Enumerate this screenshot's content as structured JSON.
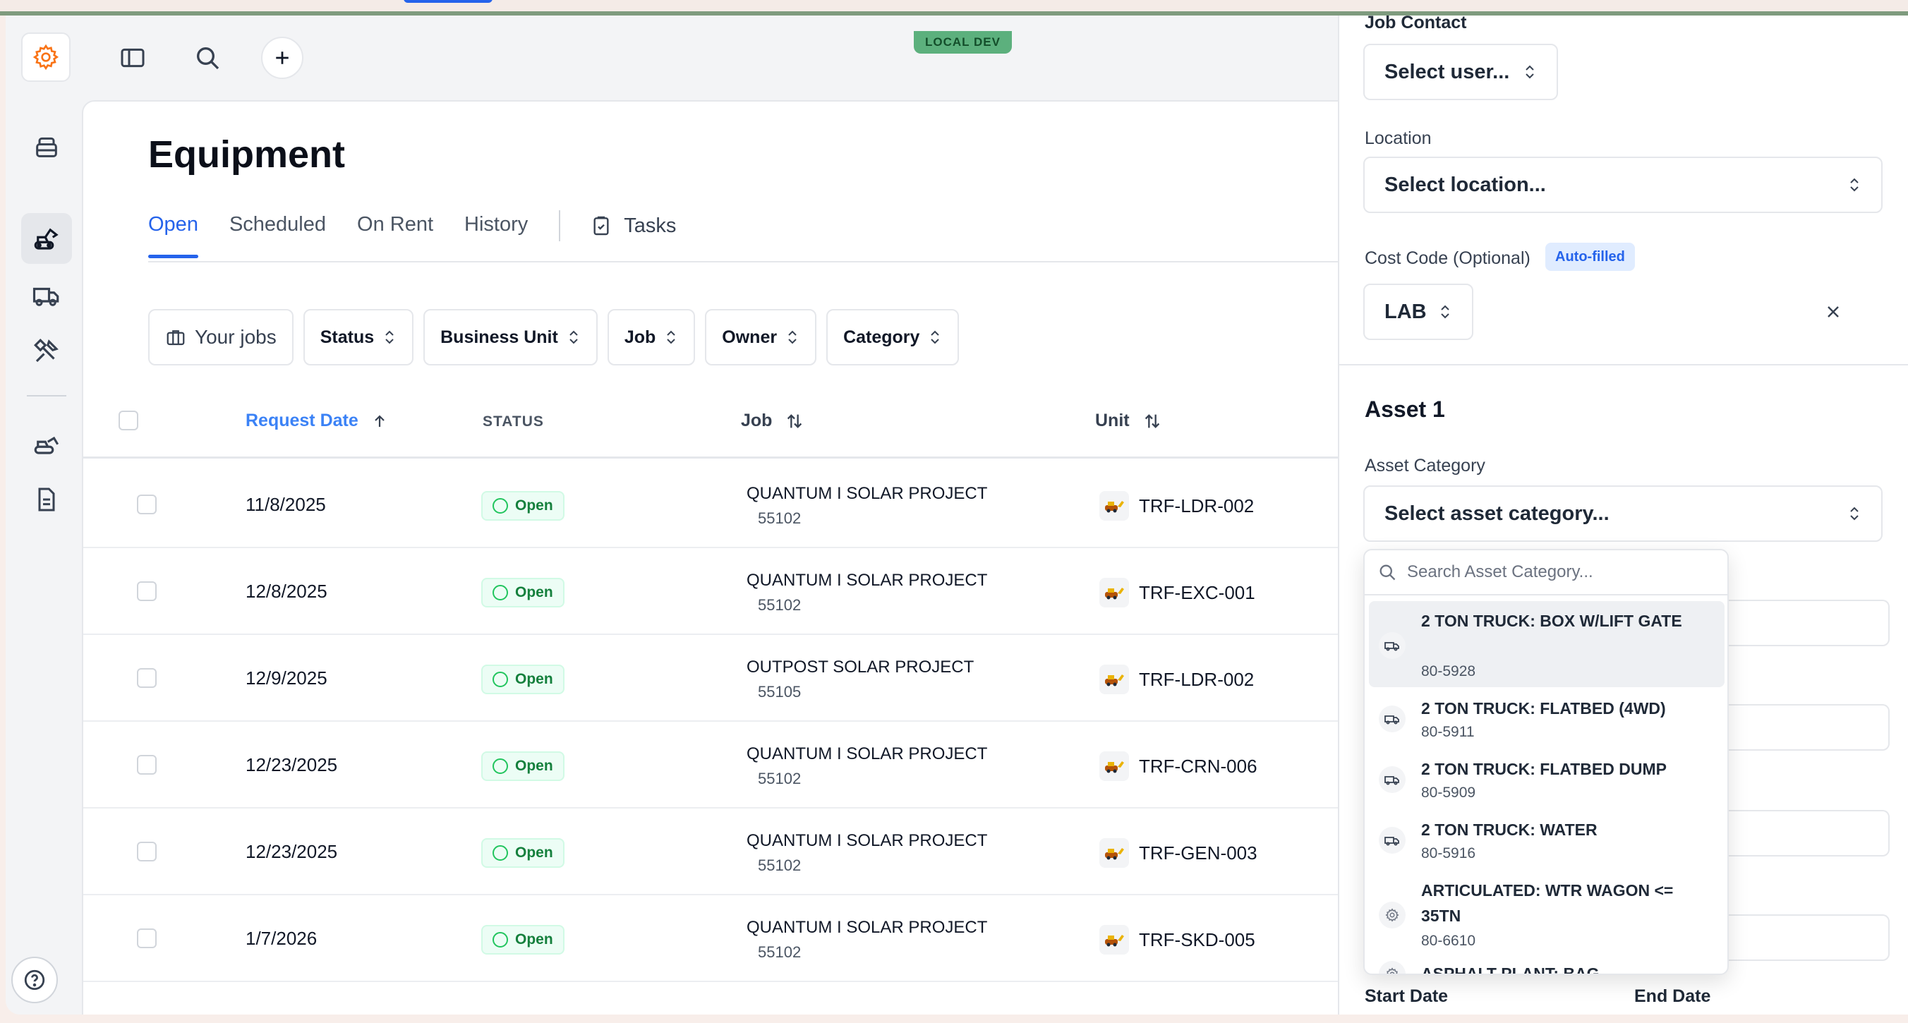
{
  "env_badge": "LOCAL DEV",
  "page": {
    "title": "Equipment",
    "tabs": [
      {
        "label": "Open",
        "active": true
      },
      {
        "label": "Scheduled",
        "active": false
      },
      {
        "label": "On Rent",
        "active": false
      },
      {
        "label": "History",
        "active": false
      }
    ],
    "tasks_label": "Tasks"
  },
  "filters": [
    "Your jobs",
    "Status",
    "Business Unit",
    "Job",
    "Owner",
    "Category"
  ],
  "table": {
    "columns": [
      "Request Date",
      "STATUS",
      "Job",
      "Unit"
    ],
    "rows": [
      {
        "date": "11/8/2025",
        "status": "Open",
        "job": "QUANTUM I SOLAR PROJECT",
        "job_num": "55102",
        "unit": "TRF-LDR-002"
      },
      {
        "date": "12/8/2025",
        "status": "Open",
        "job": "QUANTUM I SOLAR PROJECT",
        "job_num": "55102",
        "unit": "TRF-EXC-001"
      },
      {
        "date": "12/9/2025",
        "status": "Open",
        "job": "OUTPOST SOLAR PROJECT",
        "job_num": "55105",
        "unit": "TRF-LDR-002"
      },
      {
        "date": "12/23/2025",
        "status": "Open",
        "job": "QUANTUM I SOLAR PROJECT",
        "job_num": "55102",
        "unit": "TRF-CRN-006"
      },
      {
        "date": "12/23/2025",
        "status": "Open",
        "job": "QUANTUM I SOLAR PROJECT",
        "job_num": "55102",
        "unit": "TRF-GEN-003"
      },
      {
        "date": "1/7/2026",
        "status": "Open",
        "job": "QUANTUM I SOLAR PROJECT",
        "job_num": "55102",
        "unit": "TRF-SKD-005"
      }
    ]
  },
  "side_panel": {
    "job_contact_label": "Job Contact",
    "job_contact_value": "Select user...",
    "location_label": "Location",
    "location_value": "Select location...",
    "cost_code_label": "Cost Code (Optional)",
    "auto_filled_badge": "Auto-filled",
    "cost_code_value": "LAB",
    "asset_title": "Asset 1",
    "asset_category_label": "Asset Category",
    "asset_category_value": "Select asset category...",
    "start_date_label": "Start Date",
    "end_date_label": "End Date"
  },
  "dropdown": {
    "search_placeholder": "Search Asset Category...",
    "items": [
      {
        "name": "2 TON TRUCK: BOX W/LIFT GATE",
        "code": "80-5928",
        "icon": "truck-icon"
      },
      {
        "name": "2 TON TRUCK: FLATBED (4WD)",
        "code": "80-5911",
        "icon": "truck-icon"
      },
      {
        "name": "2 TON TRUCK: FLATBED DUMP",
        "code": "80-5909",
        "icon": "truck-icon"
      },
      {
        "name": "2 TON TRUCK: WATER",
        "code": "80-5916",
        "icon": "truck-icon"
      },
      {
        "name": "ARTICULATED: WTR WAGON <= 35TN",
        "code": "80-6610",
        "icon": "gear-icon"
      },
      {
        "name": "ASPHALT PLANT: BAG",
        "code": "",
        "icon": "gear-icon"
      }
    ]
  },
  "colors": {
    "accent": "#2563eb",
    "status_green": "#15803d",
    "env_badge": "#5cb07d"
  }
}
